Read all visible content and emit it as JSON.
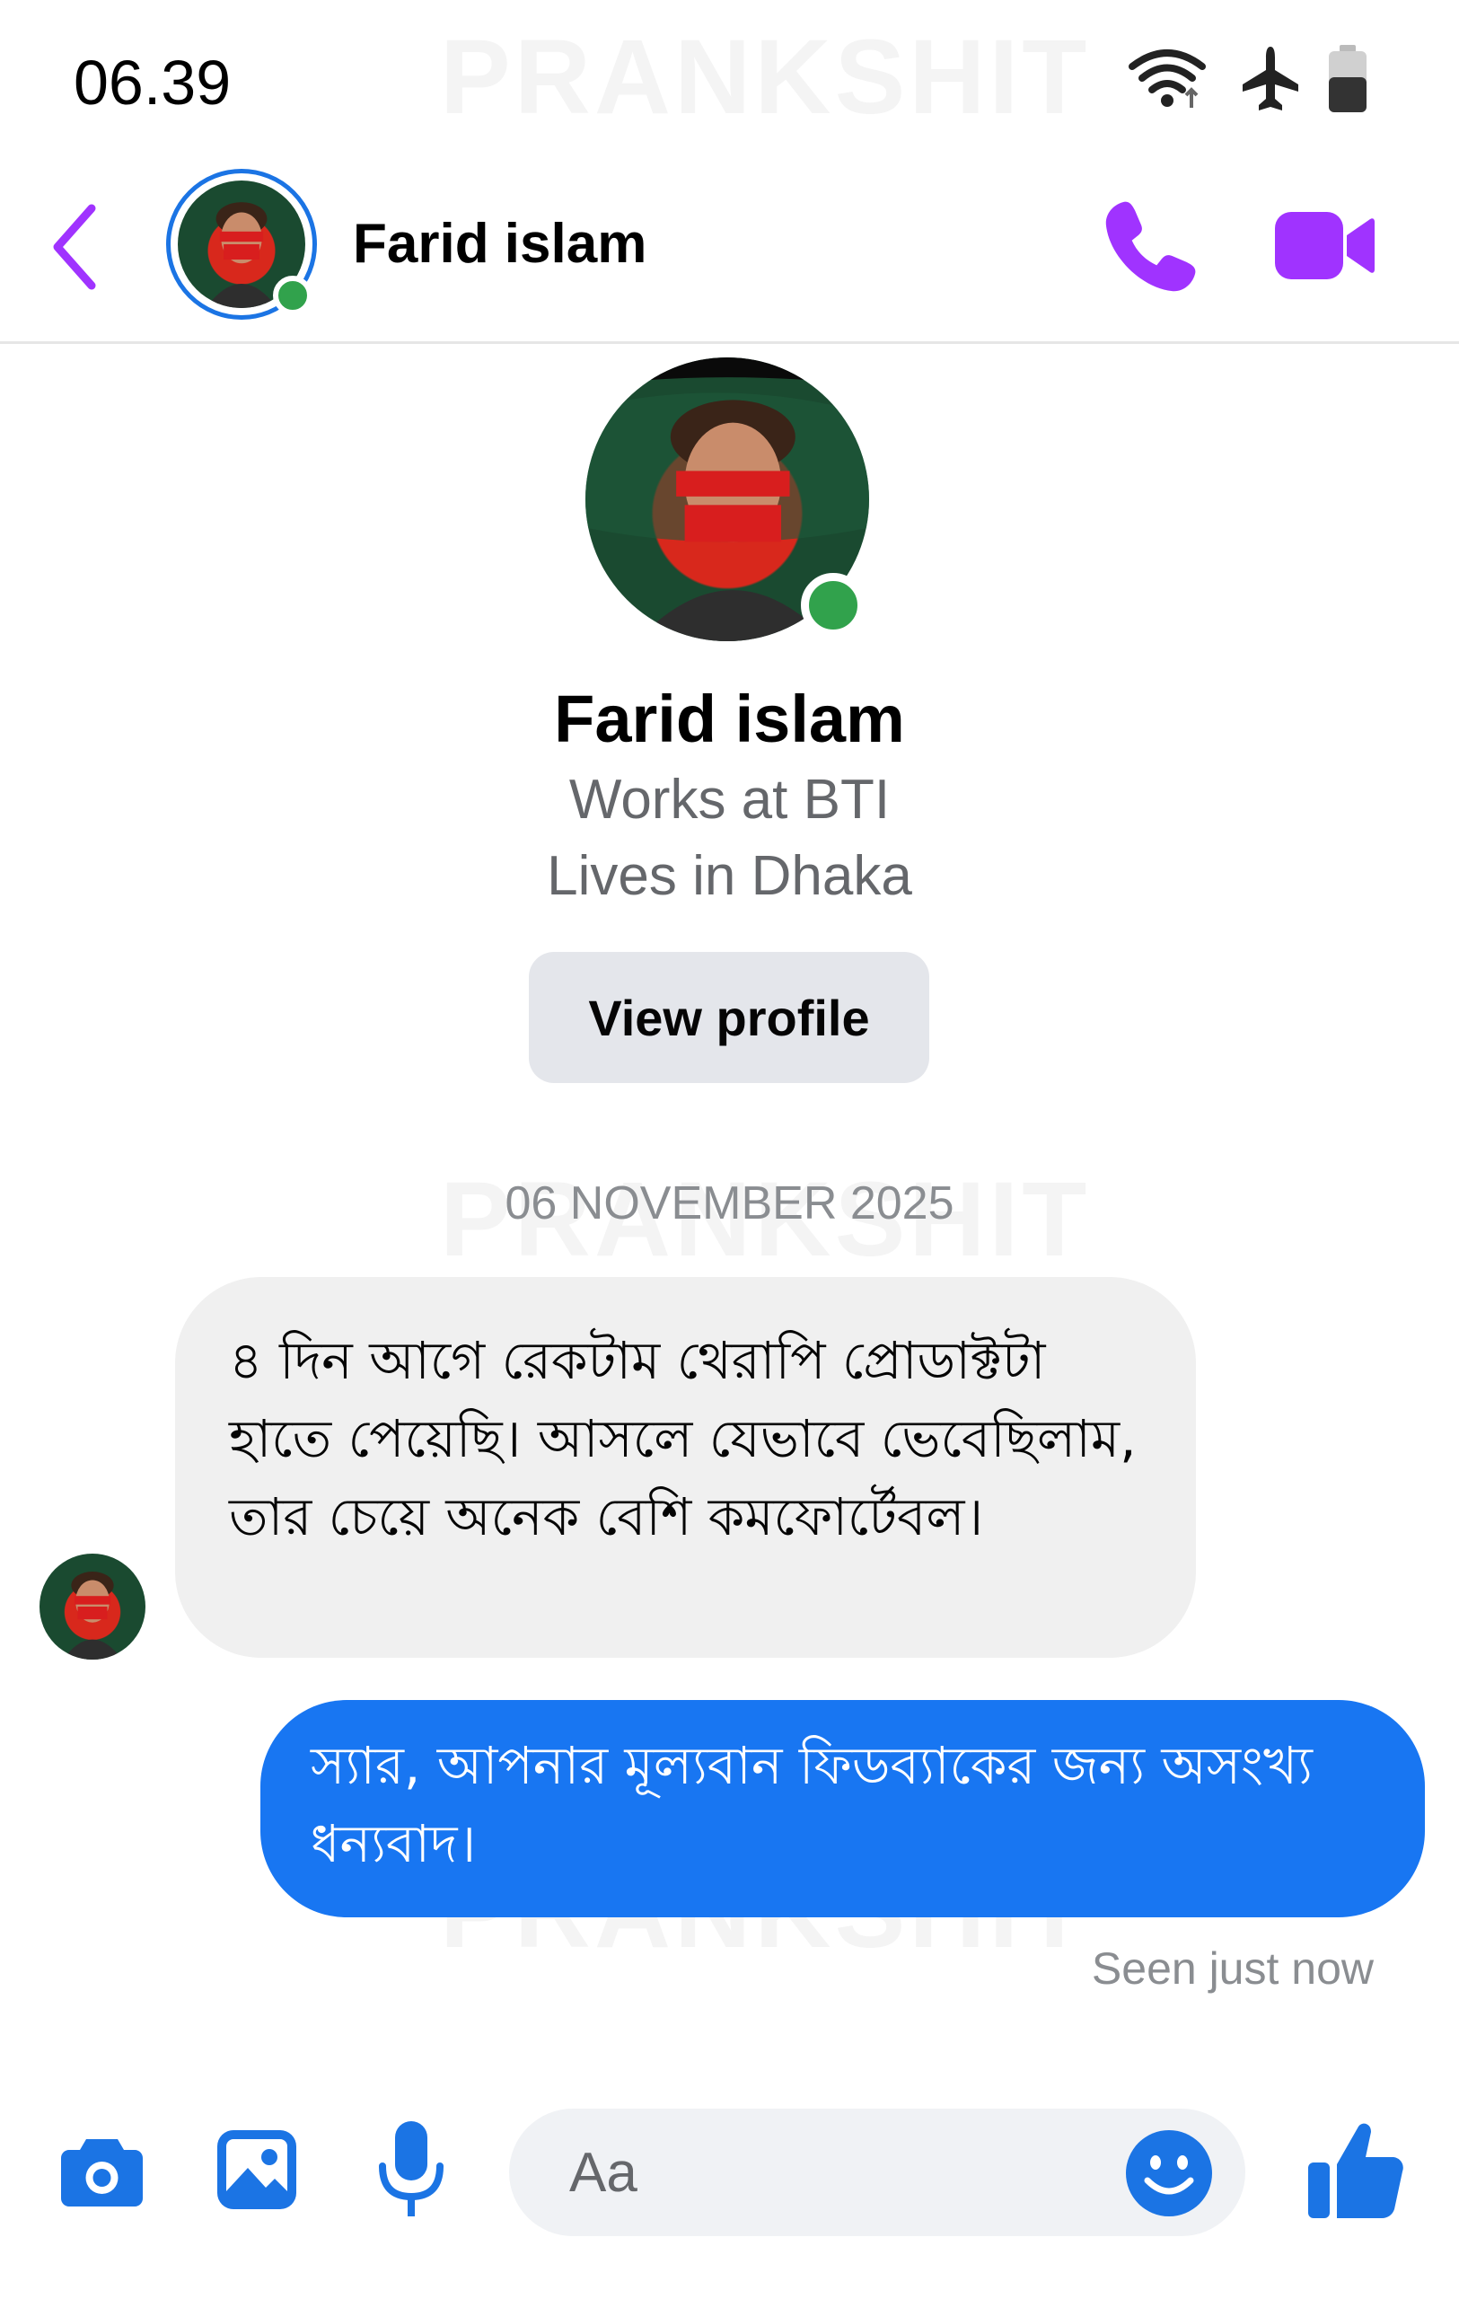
{
  "status_bar": {
    "time": "06.39",
    "watermark": "PRANKSHIT",
    "icons": [
      "wifi-icon",
      "airplane-mode-icon",
      "battery-icon"
    ]
  },
  "header": {
    "contact_name": "Farid islam",
    "back_icon": "chevron-left-icon",
    "call_icon": "phone-icon",
    "video_icon": "video-camera-icon",
    "accent_color": "#a033ff"
  },
  "profile": {
    "name": "Farid islam",
    "work": "Works at BTI",
    "home": "Lives in Dhaka",
    "view_profile_label": "View profile",
    "online_color": "#31a24c"
  },
  "conversation": {
    "date": "06 NOVEMBER 2025",
    "messages": [
      {
        "sender": "contact",
        "text": "৪ দিন আগে রেকটাম থেরাপি প্রোডাক্টটা হাতে পেয়েছি। আসলে যেভাবে ভেবেছিলাম, তার চেয়ে অনেক বেশি কমফোর্টেবল।"
      },
      {
        "sender": "me",
        "text": "স্যার, আপনার মূল্যবান ফিডব্যাকের জন্য অসংখ্য ধন্যবাদ।"
      }
    ],
    "seen_status": "Seen just now",
    "outgoing_color": "#1876f2",
    "incoming_color": "#f0f0f0"
  },
  "composer": {
    "placeholder": "Aa",
    "icons": [
      "camera-icon",
      "gallery-icon",
      "microphone-icon",
      "emoji-icon",
      "thumbs-up-icon"
    ],
    "icon_color": "#1b74e4"
  }
}
